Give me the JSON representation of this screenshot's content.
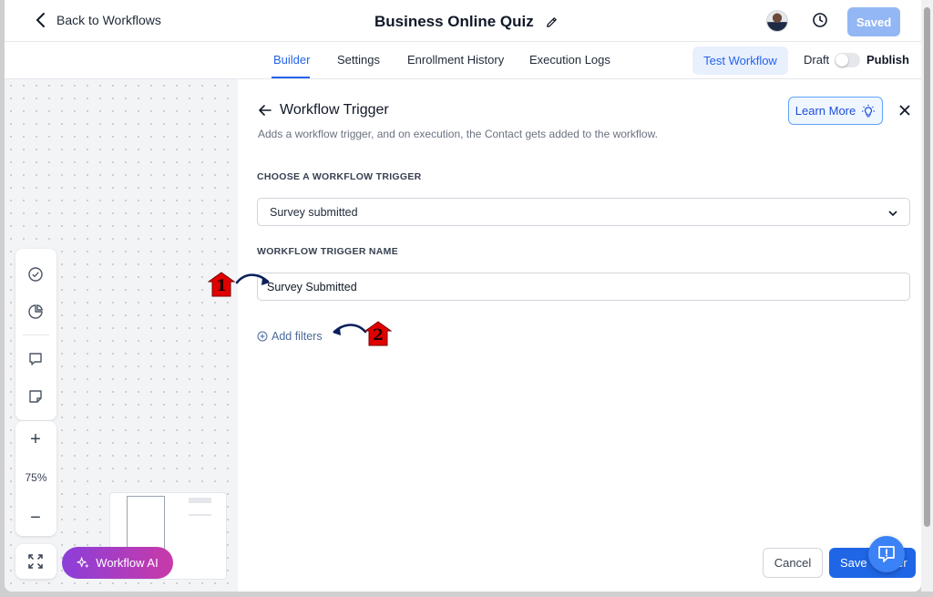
{
  "header": {
    "back_label": "Back to Workflows",
    "title": "Business Online Quiz",
    "saved_label": "Saved"
  },
  "tabs": [
    {
      "label": "Builder",
      "active": true
    },
    {
      "label": "Settings"
    },
    {
      "label": "Enrollment History"
    },
    {
      "label": "Execution Logs"
    }
  ],
  "actions": {
    "test_label": "Test Workflow",
    "draft_label": "Draft",
    "publish_label": "Publish",
    "publish_enabled": false
  },
  "canvas": {
    "zoom_level": "75%",
    "ai_label": "Workflow AI"
  },
  "panel": {
    "title": "Workflow Trigger",
    "description": "Adds a workflow trigger, and on execution, the Contact gets added to the workflow.",
    "learn_more_label": "Learn More",
    "trigger_section_label": "CHOOSE A WORKFLOW TRIGGER",
    "trigger_selected": "Survey submitted",
    "name_section_label": "WORKFLOW TRIGGER NAME",
    "trigger_name_value": "Survey Submitted",
    "add_filters_label": "Add filters",
    "cancel_label": "Cancel",
    "save_label": "Save Trigger"
  },
  "annotations": [
    {
      "number": "1"
    },
    {
      "number": "2"
    }
  ],
  "colors": {
    "accent": "#2563eb",
    "saved_button": "#93b7f5",
    "ai_gradient_start": "#8b3fd9",
    "ai_gradient_end": "#c83aa8",
    "badge_red": "#e10000",
    "arrow_navy": "#0b1f5c"
  }
}
